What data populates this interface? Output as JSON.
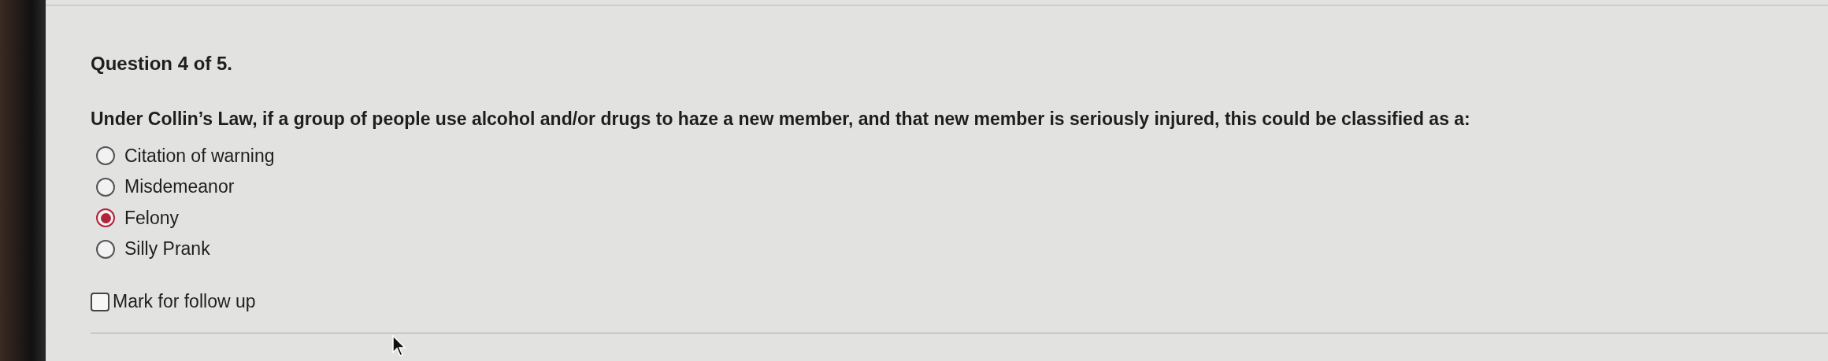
{
  "question": {
    "heading": "Question 4 of 5.",
    "prompt": "Under Collin’s Law, if a group of people use alcohol and/or drugs to haze a new member, and that new member is seriously injured, this could be classified as a:",
    "options": [
      {
        "label": "Citation of warning",
        "selected": false
      },
      {
        "label": "Misdemeanor",
        "selected": false
      },
      {
        "label": "Felony",
        "selected": true
      },
      {
        "label": "Silly Prank",
        "selected": false
      }
    ],
    "follow_up": {
      "label": "Mark for follow up",
      "checked": false
    }
  }
}
